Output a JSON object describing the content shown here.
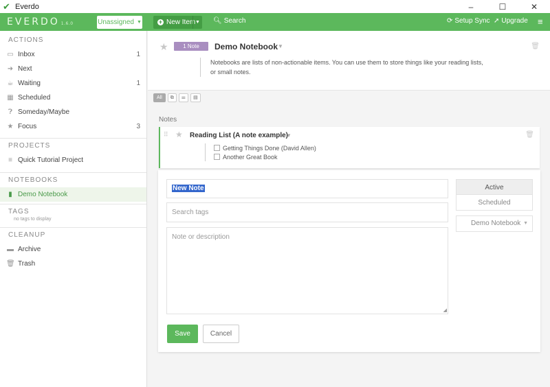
{
  "window": {
    "title": "Everdo",
    "controls": [
      "–",
      "☐",
      "✕"
    ]
  },
  "topbar": {
    "logo": "EVERDO",
    "version": "1.6.0",
    "assign_label": "Unassigned",
    "new_item_label": "New Item",
    "search_label": "Search",
    "setup_sync_label": "Setup Sync",
    "upgrade_label": "Upgrade",
    "accent": "#5cb85c"
  },
  "sidebar": {
    "actions": {
      "heading": "ACTIONS",
      "items": [
        {
          "label": "Inbox",
          "count": "1",
          "icon": "inbox-icon"
        },
        {
          "label": "Next",
          "count": "",
          "icon": "next-icon"
        },
        {
          "label": "Waiting",
          "count": "1",
          "icon": "coffee-icon"
        },
        {
          "label": "Scheduled",
          "count": "",
          "icon": "calendar-icon"
        },
        {
          "label": "Someday/Maybe",
          "count": "",
          "icon": "question-icon"
        },
        {
          "label": "Focus",
          "count": "3",
          "icon": "star-icon"
        }
      ]
    },
    "projects": {
      "heading": "PROJECTS",
      "items": [
        {
          "label": "Quick Tutorial Project"
        }
      ]
    },
    "notebooks": {
      "heading": "NOTEBOOKS",
      "items": [
        {
          "label": "Demo Notebook"
        }
      ]
    },
    "tags": {
      "heading": "TAGS",
      "empty": "no tags to display"
    },
    "cleanup": {
      "heading": "CLEANUP",
      "items": [
        {
          "label": "Archive"
        },
        {
          "label": "Trash"
        }
      ]
    }
  },
  "notebook": {
    "badge": "1 Note",
    "title": "Demo Notebook",
    "description": "Notebooks are lists of non-actionable items. You can use them to store things like your reading lists, or small notes."
  },
  "filters": {
    "all_label": "All",
    "icons": [
      "copy",
      "sliders",
      "document"
    ]
  },
  "notes": {
    "label": "Notes",
    "items": [
      {
        "title": "Reading List (A note example)",
        "checklist": [
          "Getting Things Done (David Allen)",
          "Another Great Book"
        ]
      }
    ]
  },
  "form": {
    "title_value": "New Note",
    "tags_placeholder": "Search tags",
    "desc_placeholder": "Note or description",
    "status_active": "Active",
    "status_scheduled": "Scheduled",
    "notebook_value": "Demo Notebook",
    "save_label": "Save",
    "cancel_label": "Cancel"
  }
}
